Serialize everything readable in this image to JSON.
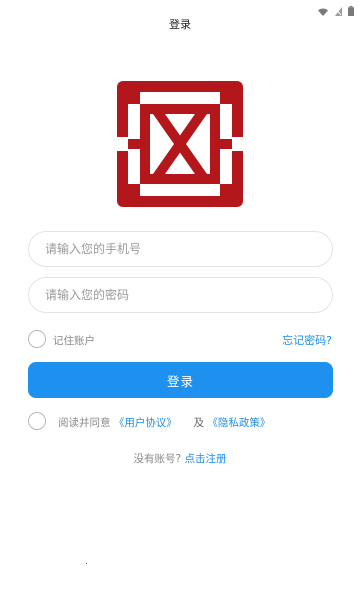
{
  "header": {
    "title": "登录"
  },
  "status_bar": {
    "icons": [
      "wifi-icon",
      "no-sim-icon",
      "battery-icon"
    ]
  },
  "logo": {
    "description_icon": "seal-logo-icon",
    "color": "#b3161b"
  },
  "form": {
    "phone_placeholder": "请输入您的手机号",
    "password_placeholder": "请输入您的密码",
    "remember_label": "记住账户",
    "forgot_label": "忘记密码?",
    "login_label": "登录"
  },
  "agreement": {
    "prefix": "阅读并同意",
    "user_agreement": "《用户协议》",
    "and": "及",
    "privacy_policy": "《隐私政策》"
  },
  "register": {
    "prompt": "没有账号?",
    "link": "点击注册"
  },
  "colors": {
    "accent": "#1e90f0",
    "link": "#1f8ee6"
  }
}
